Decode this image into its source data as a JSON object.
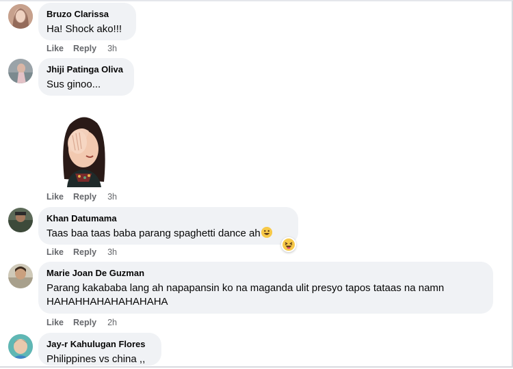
{
  "comments": [
    {
      "name": "Bruzo Clarissa",
      "text": "Ha! Shock ako!!!",
      "like": "Like",
      "reply": "Reply",
      "time": "3h"
    },
    {
      "name": "Jhiji Patinga Oliva",
      "text": "Sus ginoo...",
      "like": "Like",
      "reply": "Reply",
      "time": "3h"
    },
    {
      "name": "Khan Datumama",
      "text": "Taas baa taas baba parang spaghetti dance ah",
      "like": "Like",
      "reply": "Reply",
      "time": "3h"
    },
    {
      "name": "Marie Joan De Guzman",
      "text_line1": "Parang kakababa lang ah napapansin ko na maganda ulit presyo tapos tataas na namn",
      "text_line2": "HAHAHHAHAHAHAHAHA",
      "like": "Like",
      "reply": "Reply",
      "time": "2h"
    },
    {
      "name": "Jay-r Kahulugan Flores",
      "text": "Philippines vs china ,,"
    }
  ],
  "icons": {
    "smile_emoji": "grinning-face-icon",
    "reaction": "laughing-reaction-icon",
    "sticker": "facepalm-sticker"
  }
}
